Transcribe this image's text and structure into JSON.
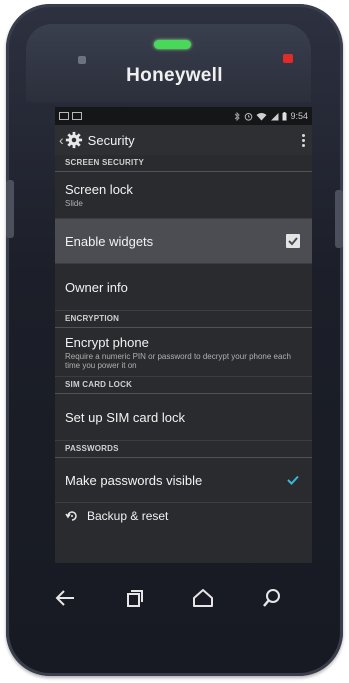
{
  "device": {
    "brand": "Honeywell"
  },
  "statusbar": {
    "time": "9:54"
  },
  "appbar": {
    "title": "Security"
  },
  "sections": {
    "screen_security": "SCREEN SECURITY",
    "encryption": "ENCRYPTION",
    "sim_card_lock": "SIM CARD LOCK",
    "passwords": "PASSWORDS"
  },
  "items": {
    "screen_lock": {
      "title": "Screen lock",
      "summary": "Slide"
    },
    "enable_widgets": {
      "title": "Enable widgets",
      "checked": true
    },
    "owner_info": {
      "title": "Owner info"
    },
    "encrypt_phone": {
      "title": "Encrypt phone",
      "summary": "Require a numeric PIN or password to decrypt your phone each time you power it on"
    },
    "sim_lock": {
      "title": "Set up SIM card lock"
    },
    "make_passwords_visible": {
      "title": "Make passwords visible",
      "checked": true
    },
    "backup_reset": {
      "title": "Backup & reset"
    }
  },
  "colors": {
    "accent": "#3ab8d8",
    "speaker_led": "#4ad85a",
    "notification_led": "#e12a2a"
  }
}
